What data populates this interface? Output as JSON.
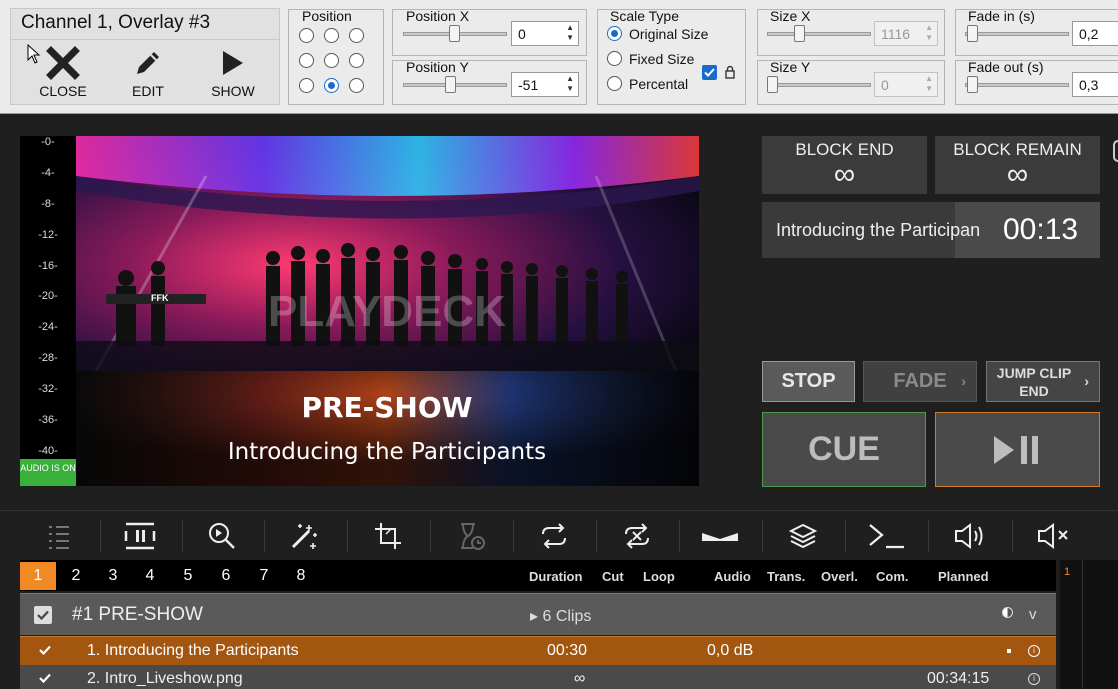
{
  "channel": {
    "title": "Channel 1, Overlay #3",
    "close": "CLOSE",
    "edit": "EDIT",
    "show": "SHOW"
  },
  "position": {
    "label": "Position",
    "selected": "bottom-center"
  },
  "position_x": {
    "label": "Position X",
    "value": "0"
  },
  "position_y": {
    "label": "Position Y",
    "value": "-51"
  },
  "scale": {
    "label": "Scale Type",
    "options": [
      "Original Size",
      "Fixed Size",
      "Percental"
    ],
    "selected": "Original Size",
    "lock_checked": true
  },
  "size_x": {
    "label": "Size X",
    "value": "1116"
  },
  "size_y": {
    "label": "Size Y",
    "value": "0"
  },
  "fade_in": {
    "label": "Fade in (s)",
    "value": "0,2"
  },
  "fade_out": {
    "label": "Fade out (s)",
    "value": "0,3"
  },
  "vu": {
    "ticks": [
      "-0-",
      "-4-",
      "-8-",
      "-12-",
      "-16-",
      "-20-",
      "-24-",
      "-28-",
      "-32-",
      "-36-",
      "-40-"
    ],
    "audio": "AUDIO IS ON"
  },
  "preview": {
    "watermark": "PLAYDECK",
    "title": "PRE-SHOW",
    "subtitle": "Introducing the Participants",
    "ffk": "FFK"
  },
  "info": {
    "block_end": "BLOCK END",
    "block_end_val": "∞",
    "block_remain": "BLOCK REMAIN",
    "block_remain_val": "∞",
    "clip_name": "Introducing the Participan",
    "clip_time": "00:13",
    "clip_progress": 0.57
  },
  "controls": {
    "stop": "STOP",
    "fade": "FADE",
    "jump": "JUMP CLIP END",
    "cue": "CUE"
  },
  "toolbar": [
    "list-icon",
    "pause-icon",
    "zoom-icon",
    "magic-wand-icon",
    "crop-icon",
    "hourglass-icon",
    "loop-icon",
    "shuffle-icon",
    "fade-curve-icon",
    "layers-icon",
    "console-icon",
    "volume-icon",
    "mute-icon"
  ],
  "tabs": [
    "1",
    "2",
    "3",
    "4",
    "5",
    "6",
    "7",
    "8"
  ],
  "active_tab": "1",
  "columns": {
    "duration": "Duration",
    "cut": "Cut",
    "loop": "Loop",
    "audio": "Audio",
    "trans": "Trans.",
    "overl": "Overl.",
    "com": "Com.",
    "planned": "Planned"
  },
  "block": {
    "name": "#1  PRE-SHOW",
    "clips": "▸ 6 Clips",
    "checked": true
  },
  "rows": [
    {
      "name": "1.  Introducing the Participants",
      "duration": "00:30",
      "audio": "0,0 dB",
      "planned": ""
    },
    {
      "name": "2.  Intro_Liveshow.png",
      "duration": "∞",
      "audio": "",
      "planned": "00:34:15"
    }
  ],
  "sidebar": {
    "marker": "1"
  },
  "colors": {
    "accent": "#f08a24",
    "row_active": "#a2560f",
    "audio_on": "#3ab13a",
    "cue_border": "#4c9a4c",
    "play_border": "#d07a2a"
  }
}
